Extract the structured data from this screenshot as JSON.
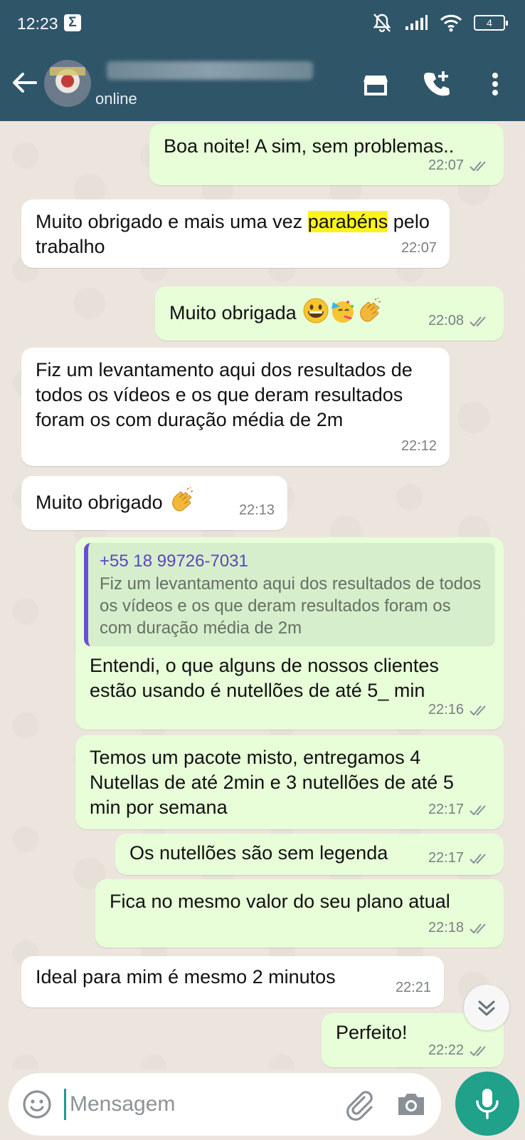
{
  "status_bar": {
    "time": "12:23",
    "battery": "4"
  },
  "header": {
    "contact_status": "online"
  },
  "messages": [
    {
      "dir": "out",
      "text": "Boa noite! A sim, sem problemas..",
      "time": "22:07"
    },
    {
      "dir": "in",
      "text_before": "Muito obrigado e mais uma vez ",
      "highlight": "parabéns",
      "text_after": " pelo trabalho",
      "time": "22:07"
    },
    {
      "dir": "out",
      "text": "Muito obrigada",
      "emojis": [
        "grinning-face",
        "partying-face",
        "clapping-hands"
      ],
      "time": "22:08"
    },
    {
      "dir": "in",
      "text": "Fiz um levantamento aqui dos resultados de todos os vídeos e os que deram resultados foram os com duração média de 2m",
      "time": "22:12"
    },
    {
      "dir": "in",
      "text": "Muito obrigado",
      "emojis": [
        "clapping-hands"
      ],
      "time": "22:13"
    },
    {
      "dir": "out",
      "quote_sender": "+55 18 99726-7031",
      "quote_text": "Fiz um levantamento aqui dos resultados de todos os vídeos e os que deram resultados foram os com duração média de 2m",
      "text": "Entendi, o que alguns de nossos clientes estão usando é nutellões de até 5_ min",
      "time": "22:16"
    },
    {
      "dir": "out",
      "text": "Temos um pacote misto, entregamos 4 Nutellas de até 2min e 3 nutellões de até 5 min por semana",
      "time": "22:17"
    },
    {
      "dir": "out",
      "text": "Os nutellões são sem legenda",
      "time": "22:17"
    },
    {
      "dir": "out",
      "text": "Fica no mesmo valor do seu plano atual",
      "time": "22:18"
    },
    {
      "dir": "in",
      "text": "Ideal para mim é mesmo 2 minutos",
      "time": "22:21"
    },
    {
      "dir": "out",
      "text": "Perfeito!",
      "time": "22:22"
    }
  ],
  "composer": {
    "placeholder": "Mensagem"
  },
  "icons": {
    "back": "arrow-left-icon",
    "store": "store-icon",
    "call": "add-call-icon",
    "menu": "more-vert-icon",
    "emoji": "emoji-icon",
    "attach": "paperclip-icon",
    "camera": "camera-icon",
    "mic": "mic-icon",
    "scroll_down": "chevron-double-down-icon",
    "read": "double-check-icon"
  },
  "colors": {
    "header": "#2f5568",
    "outgoing": "#e7fed8",
    "incoming": "#ffffff",
    "accent": "#1fa18a",
    "highlight": "#fdf21c"
  }
}
